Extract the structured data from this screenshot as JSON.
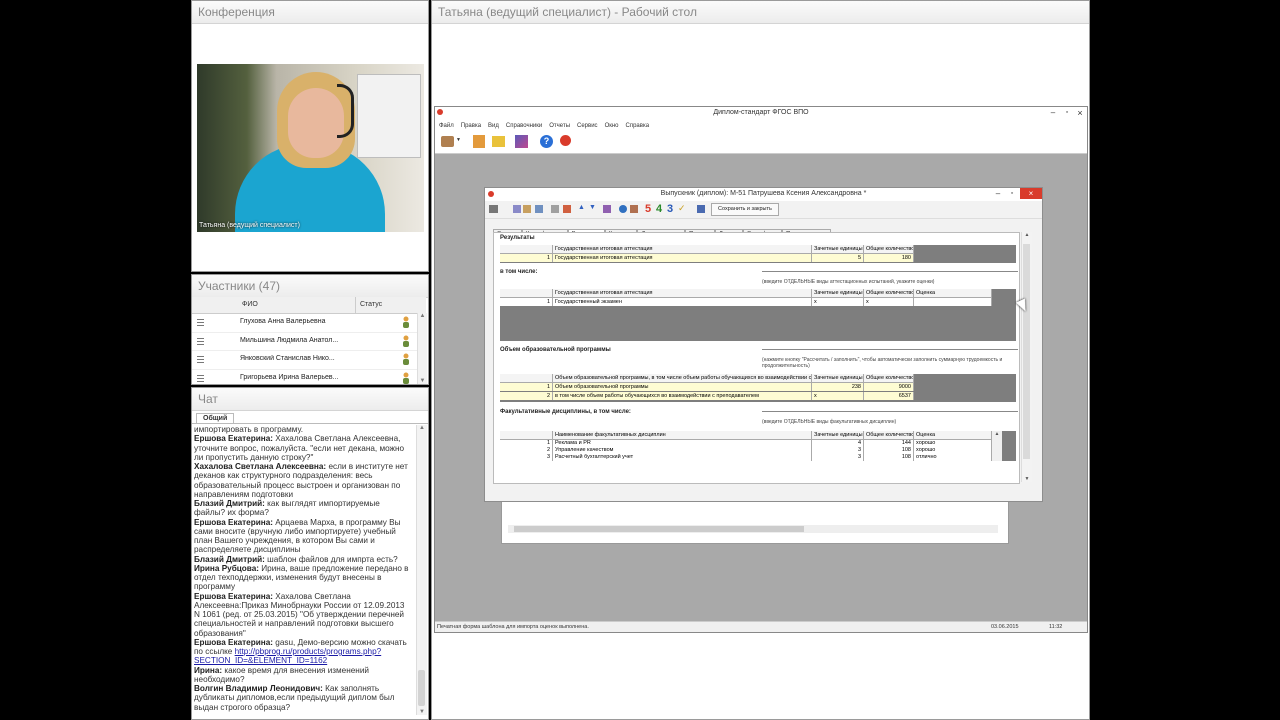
{
  "conference": {
    "title": "Конференция",
    "video_label": "Татьяна (ведущий специалист)"
  },
  "participants": {
    "title": "Участники (47)",
    "col_name": "ФИО",
    "col_status": "Статус",
    "rows": [
      {
        "name": "Глухова Анна Валерьевна"
      },
      {
        "name": "Мильшина Людмила  Анатол..."
      },
      {
        "name": "Янковский Станислав  Нико..."
      },
      {
        "name": "Григорьева Ирина  Валерьев..."
      }
    ]
  },
  "chat": {
    "title": "Чат",
    "tab": "Общий",
    "messages": [
      {
        "author": "",
        "text": "импортировать в программу."
      },
      {
        "author": "Ершова Екатерина:",
        "text": "Хахалова Светлана Алексеевна, уточните вопрос, пожалуйста. \"если нет декана, можно ли пропустить данную строку?\""
      },
      {
        "author": "Хахалова Светлана  Алексеевна:",
        "text": "если в институте нет деканов как структурного подразделения: весь образовательный процесс выстроен и организован по направлениям подготовки"
      },
      {
        "author": "Блазий Дмитрий:",
        "text": "как выглядят импортируемые файлы? их форма?"
      },
      {
        "author": "Ершова Екатерина:",
        "text": "Арцаева Марха, в программу Вы сами вносите (вручную либо импортируете) учебный план Вашего учреждения, в котором Вы сами и распределяете дисциплины"
      },
      {
        "author": "Блазий Дмитрий:",
        "text": "шаблон файлов для импрта есть?"
      },
      {
        "author": "Ирина Рубцова:",
        "text": "Ирина, ваше предложение передано в отдел техподдержки, изменения будут внесены в программу"
      },
      {
        "author": "Ершова Екатерина:",
        "text": "Хахалова Светлана Алексеевна:Приказ Минобрнауки России от 12.09.2013 N 1061 (ред. от 25.03.2015) \"Об утверждении перечней специальностей и направлений подготовки высшего образования\""
      },
      {
        "author": "Ершова Екатерина:",
        "text": "gasu, Демо-версию можно скачать по ссылке ",
        "link": "http://pbprog.ru/products/programs.php?SECTION_ID=&ELEMENT_ID=1162"
      },
      {
        "author": "Ирина:",
        "text": "какое время для внесения изменений необходимо?"
      },
      {
        "author": "Волгин Владимир   Леонидович:",
        "text": "Как заполнять дубликаты дипломов,если предыдущий диплом был выдан  строгого образца?"
      }
    ]
  },
  "desktop": {
    "title": "Татьяна (ведущий специалист) - Рабочий стол",
    "app": {
      "title": "Диплом-стандарт ФГОС ВПО",
      "menu": [
        "Файл",
        "Правка",
        "Вид",
        "Справочники",
        "Отчеты",
        "Сервис",
        "Окно",
        "Справка"
      ],
      "status_left": "Печатная форма шаблона для импорта оценок выполнена.",
      "status_date": "03.06.2015",
      "status_time": "11:32"
    },
    "dialog": {
      "title": "Выпускник (диплом): М-51 Патрушева Ксения Александровна *",
      "save_close": "Сохранить и закрыть",
      "grade_digits": [
        "5",
        "4",
        "3"
      ],
      "tabs": [
        "Студент",
        "Квалификация",
        "Результаты",
        "Курсовые",
        "Дополнительно",
        "Подписи",
        "Диплом",
        "Сертификат",
        "Переподготовка"
      ],
      "active_tab": "Результаты",
      "sec_results": "Результаты",
      "t1_head": [
        "Государственная итоговая аттестация",
        "Зачетные единицы",
        "Общее количество"
      ],
      "t1_rows": [
        [
          "1",
          "Государственная итоговая аттестация",
          "5",
          "180"
        ]
      ],
      "sec_including": "в том числе:",
      "note_including": "(введите ОТДЕЛЬНЫЕ виды аттестационных испытаний, укажите оценки)",
      "t2_head": [
        "Государственная итоговая аттестация",
        "Зачетные единицы",
        "Общее количество",
        "Оценка"
      ],
      "t2_rows": [
        [
          "1",
          "Государственный экзамен",
          "х",
          "х",
          ""
        ]
      ],
      "sec_volume": "Объем образовательной программы",
      "note_volume": "(нажмите кнопку \"Рассчитать / заполнить\", чтобы автоматически заполнить суммарную трудоемкость и продолжительность)",
      "t3_head": [
        "Объем образовательной программы, в том числе объем работы обучающихся во взаимодействии с преподавателем",
        "Зачетные единицы",
        "Общее количество"
      ],
      "t3_rows": [
        [
          "1",
          "Объем образовательной программы",
          "238",
          "9000"
        ],
        [
          "2",
          "в том числе объем работы обучающихся во взаимодействии с преподавателем",
          "х",
          "6537"
        ]
      ],
      "sec_optional": "Факультативные дисциплины, в том числе:",
      "note_optional": "(введите ОТДЕЛЬНЫЕ виды факультативных дисциплин)",
      "t4_head": [
        "Наименование факультативных дисциплин",
        "Зачетные единицы",
        "Общее количество",
        "Оценка"
      ],
      "t4_rows": [
        [
          "1",
          "Реклама и PR",
          "4",
          "144",
          "хорошо"
        ],
        [
          "2",
          "Управление качеством",
          "3",
          "108",
          "хорошо"
        ],
        [
          "3",
          "Расчетный бухгалтерский учет",
          "3",
          "108",
          "отлично"
        ]
      ]
    }
  },
  "colors": {
    "accent_red": "#d93b2b",
    "yellow_row": "#fefcd3",
    "gray_fill": "#7e7e7e"
  }
}
